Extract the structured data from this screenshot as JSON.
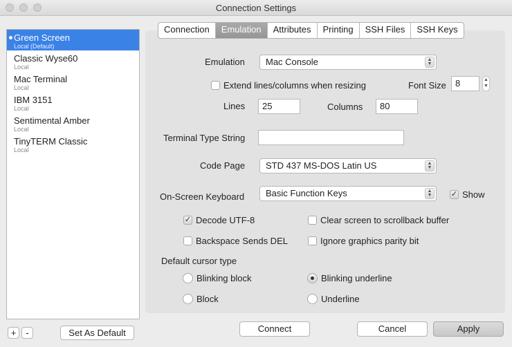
{
  "window": {
    "title": "Connection Settings"
  },
  "profiles": [
    {
      "name": "Green Screen",
      "sub": "Local  (Default)",
      "selected": true
    },
    {
      "name": "Classic Wyse60",
      "sub": "Local",
      "selected": false
    },
    {
      "name": "Mac Terminal",
      "sub": "Local",
      "selected": false
    },
    {
      "name": "IBM 3151",
      "sub": "Local",
      "selected": false
    },
    {
      "name": "Sentimental Amber",
      "sub": "Local",
      "selected": false
    },
    {
      "name": "TinyTERM Classic",
      "sub": "Local",
      "selected": false
    }
  ],
  "sidebar_buttons": {
    "add": "+",
    "remove": "-",
    "set_default": "Set As Default"
  },
  "tabs": [
    {
      "label": "Connection",
      "active": false
    },
    {
      "label": "Emulation",
      "active": true
    },
    {
      "label": "Attributes",
      "active": false
    },
    {
      "label": "Printing",
      "active": false
    },
    {
      "label": "SSH Files",
      "active": false
    },
    {
      "label": "SSH Keys",
      "active": false
    }
  ],
  "emulation": {
    "emulation_label": "Emulation",
    "emulation_value": "Mac Console",
    "extend_label": "Extend lines/columns when resizing",
    "extend_checked": false,
    "font_size_label": "Font Size",
    "font_size_value": "8",
    "lines_label": "Lines",
    "lines_value": "25",
    "columns_label": "Columns",
    "columns_value": "80",
    "terminal_type_label": "Terminal Type String",
    "terminal_type_value": "",
    "code_page_label": "Code Page",
    "code_page_value": "STD 437 MS-DOS Latin US",
    "keyboard_label": "On-Screen Keyboard",
    "keyboard_value": "Basic Function Keys",
    "show_label": "Show",
    "show_checked": true,
    "decode_utf8_label": "Decode UTF-8",
    "decode_utf8_checked": true,
    "clear_screen_label": "Clear screen to scrollback buffer",
    "clear_screen_checked": false,
    "backspace_label": "Backspace Sends DEL",
    "backspace_checked": false,
    "ignore_parity_label": "Ignore graphics parity bit",
    "ignore_parity_checked": false,
    "cursor_label": "Default cursor type",
    "cursor_options": {
      "blinking_block": "Blinking block",
      "blinking_underline": "Blinking underline",
      "block": "Block",
      "underline": "Underline"
    },
    "cursor_selected": "blinking_underline"
  },
  "footer": {
    "connect": "Connect",
    "cancel": "Cancel",
    "apply": "Apply"
  },
  "icons": {
    "check": "✓",
    "up_arrow": "▲",
    "down_arrow": "▼"
  }
}
